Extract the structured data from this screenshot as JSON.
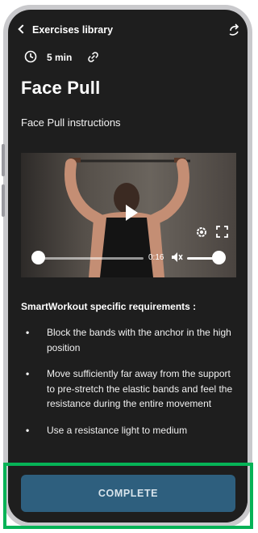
{
  "header": {
    "title": "Exercises library",
    "share_icon": "share-icon",
    "back_icon": "back-icon"
  },
  "meta": {
    "duration": "5 min",
    "clock_icon": "clock-icon",
    "link_icon": "link-icon"
  },
  "exercise": {
    "title": "Face Pull",
    "subtitle": "Face Pull instructions"
  },
  "video": {
    "current_time": "0:16",
    "progress": 0.0,
    "volume": 1.0
  },
  "requirements": {
    "title": "SmartWorkout specific requirements :",
    "bullet": "•",
    "items": [
      "Block the bands with the anchor in the high position",
      "Move sufficiently far away from the support to pre-stretch the elastic bands and feel the resistance during the entire movement",
      "Use a resistance light to medium"
    ]
  },
  "actions": {
    "complete_label": "COMPLETE"
  },
  "colors": {
    "screen_bg": "#1e1e1e",
    "button_bg": "#2e5f7e",
    "highlight": "#06b357"
  }
}
